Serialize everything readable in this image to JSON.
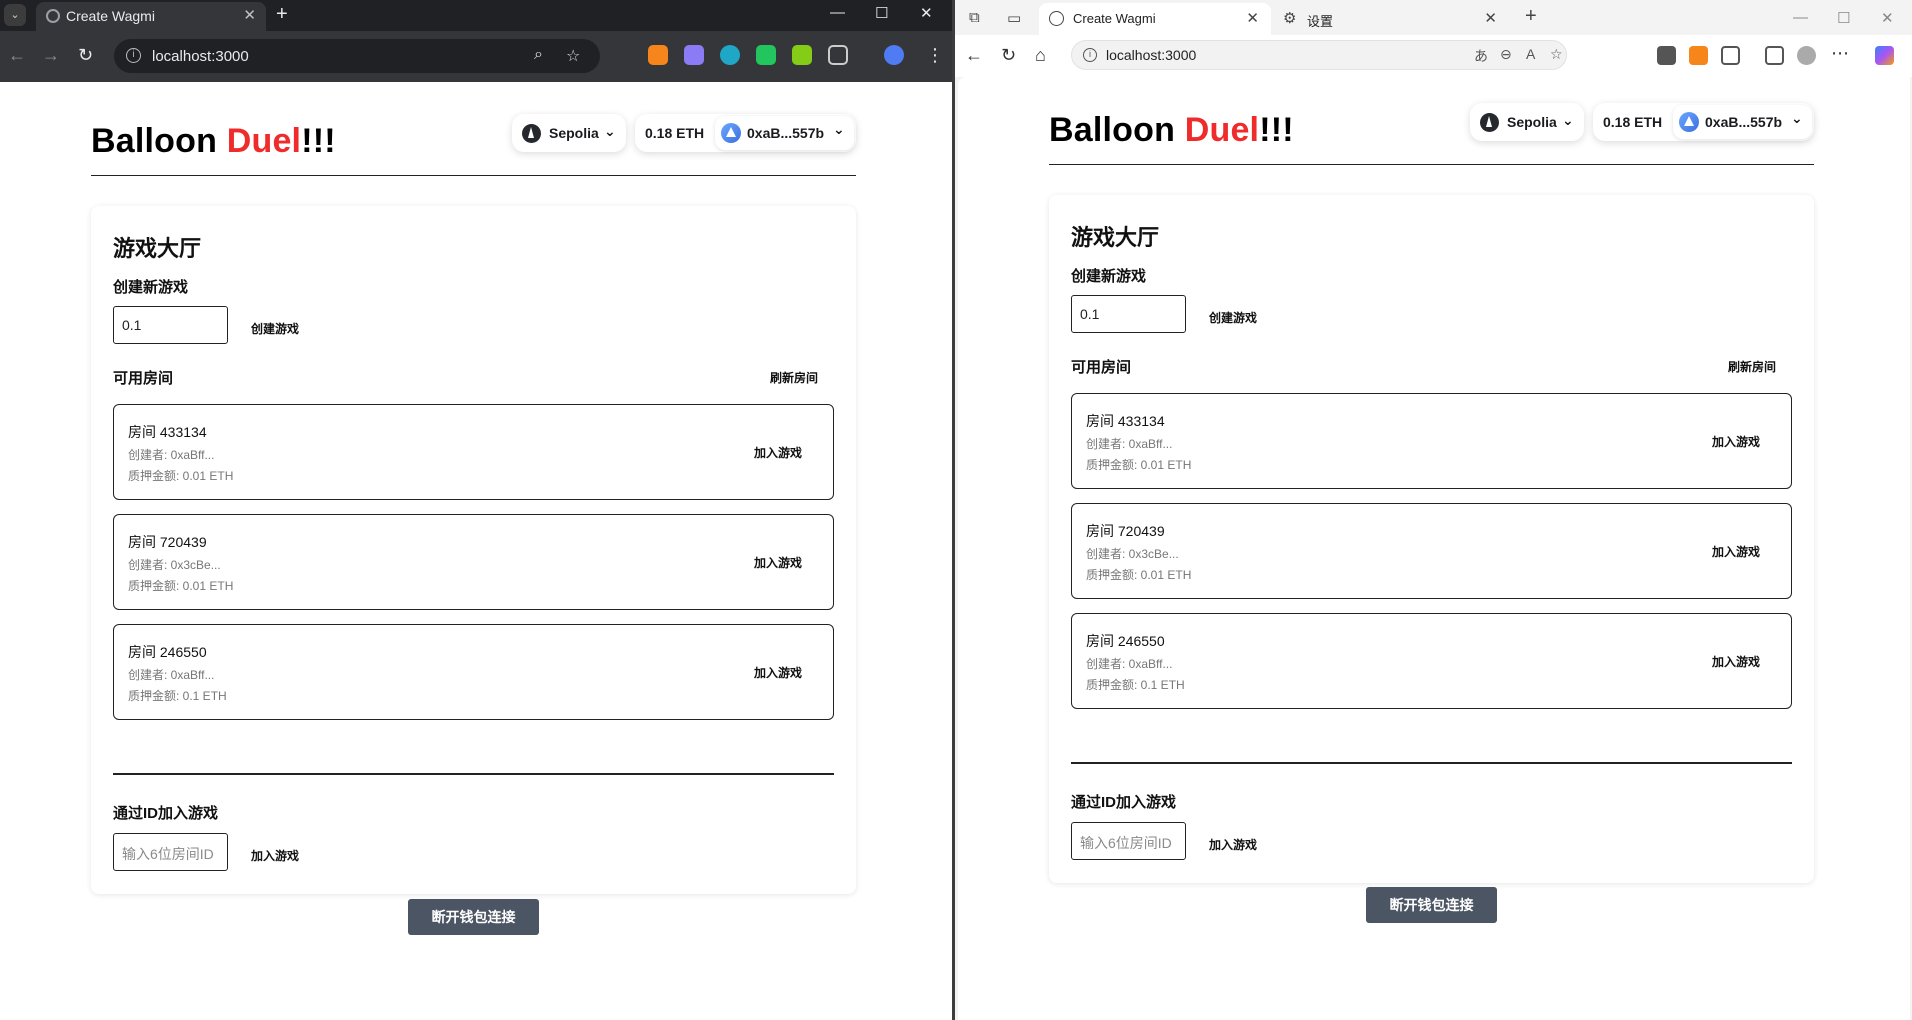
{
  "left_browser": {
    "tab_title": "Create Wagmi",
    "url": "localhost:3000"
  },
  "right_browser": {
    "tab_title": "Create Wagmi",
    "second_tab_title": "设置",
    "url": "localhost:3000"
  },
  "app": {
    "title_black": "Balloon ",
    "title_red": "Duel",
    "title_bang": "!!!",
    "network": "Sepolia",
    "balance": "0.18 ETH",
    "address": "0xaB...557b",
    "lobby_title": "游戏大厅",
    "create_heading": "创建新游戏",
    "stake_value": "0.1",
    "create_button": "创建游戏",
    "rooms_heading": "可用房间",
    "refresh_button": "刷新房间",
    "rooms": [
      {
        "title": "房间 433134",
        "creator": "创建者: 0xaBff...",
        "stake": "质押金额: 0.01 ETH",
        "join": "加入游戏"
      },
      {
        "title": "房间 720439",
        "creator": "创建者: 0x3cBe...",
        "stake": "质押金额: 0.01 ETH",
        "join": "加入游戏"
      },
      {
        "title": "房间 246550",
        "creator": "创建者: 0xaBff...",
        "stake": "质押金额: 0.1 ETH",
        "join": "加入游戏"
      }
    ],
    "join_by_id_heading": "通过ID加入游戏",
    "room_id_placeholder": "输入6位房间ID",
    "join_button": "加入游戏",
    "disconnect_button": "断开钱包连接"
  },
  "colors": {
    "accent_red": "#ef2b2b",
    "disconnect_bg": "#4b5563"
  }
}
